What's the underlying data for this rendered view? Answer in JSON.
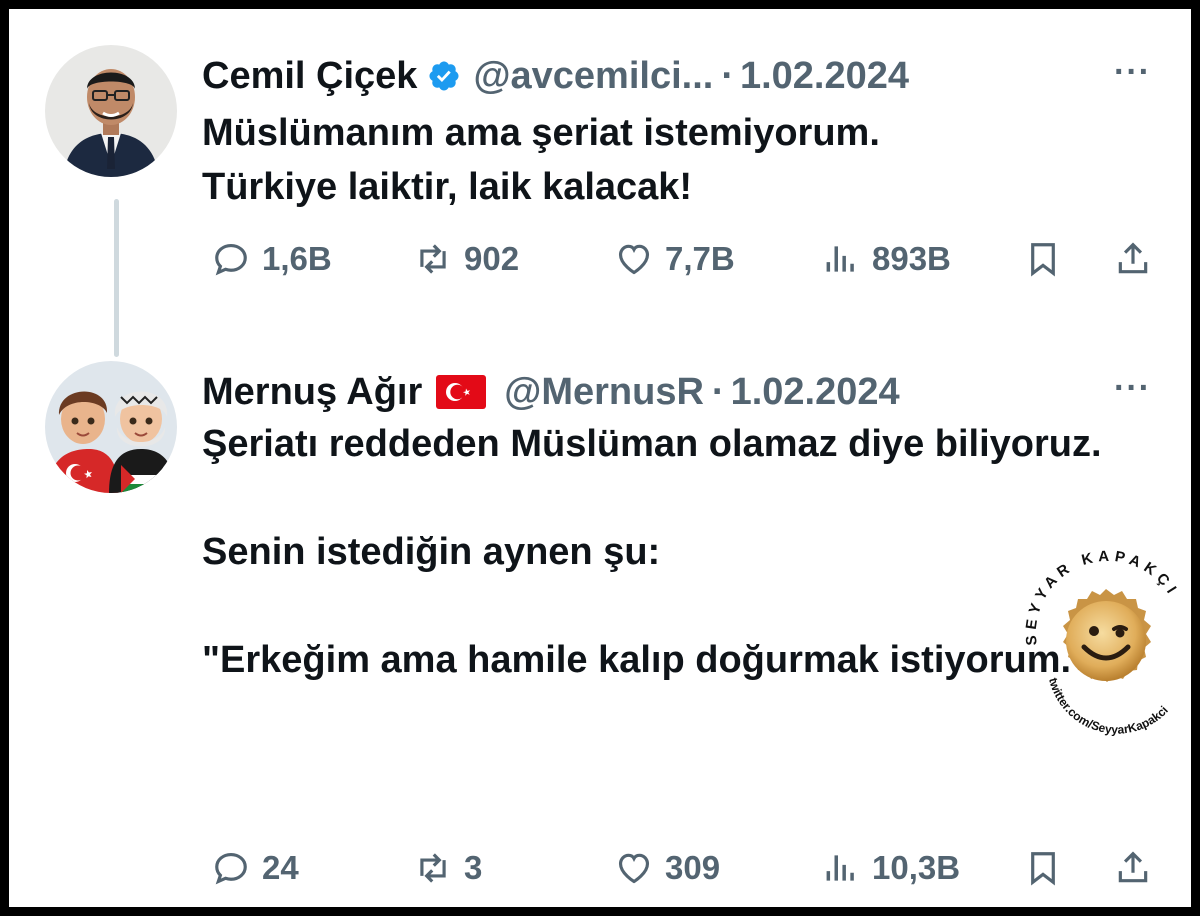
{
  "tweets": [
    {
      "name": "Cemil Çiçek",
      "verified": true,
      "handle": "@avcemilci...",
      "separator": "·",
      "date": "1.02.2024",
      "more": "···",
      "text": [
        "Müslümanım ama şeriat istemiyorum.",
        "Türkiye laiktir, laik kalacak!"
      ],
      "actions": {
        "replies": "1,6B",
        "retweets": "902",
        "likes": "7,7B",
        "views": "893B"
      }
    },
    {
      "name": "Mernuş Ağır",
      "flag": "turkey-flag",
      "handle": "@MernusR",
      "separator": "·",
      "date": "1.02.2024",
      "more": "···",
      "text": [
        "Şeriatı reddeden Müslüman olamaz diye biliyoruz.",
        "",
        "Senin istediğin aynen şu:",
        "",
        "\"Erkeğim ama hamile kalıp doğurmak istiyorum.\""
      ],
      "actions": {
        "replies": "24",
        "retweets": "3",
        "likes": "309",
        "views": "10,3B"
      }
    }
  ],
  "watermark": {
    "arc_text": "SEYYAR KAPAKÇI",
    "url_text": "twitter.com/SeyyarKapakci"
  },
  "colors": {
    "text": "#0f1419",
    "secondary": "#536471",
    "verified": "#1d9bf0",
    "thread_line": "#cfd9de"
  }
}
